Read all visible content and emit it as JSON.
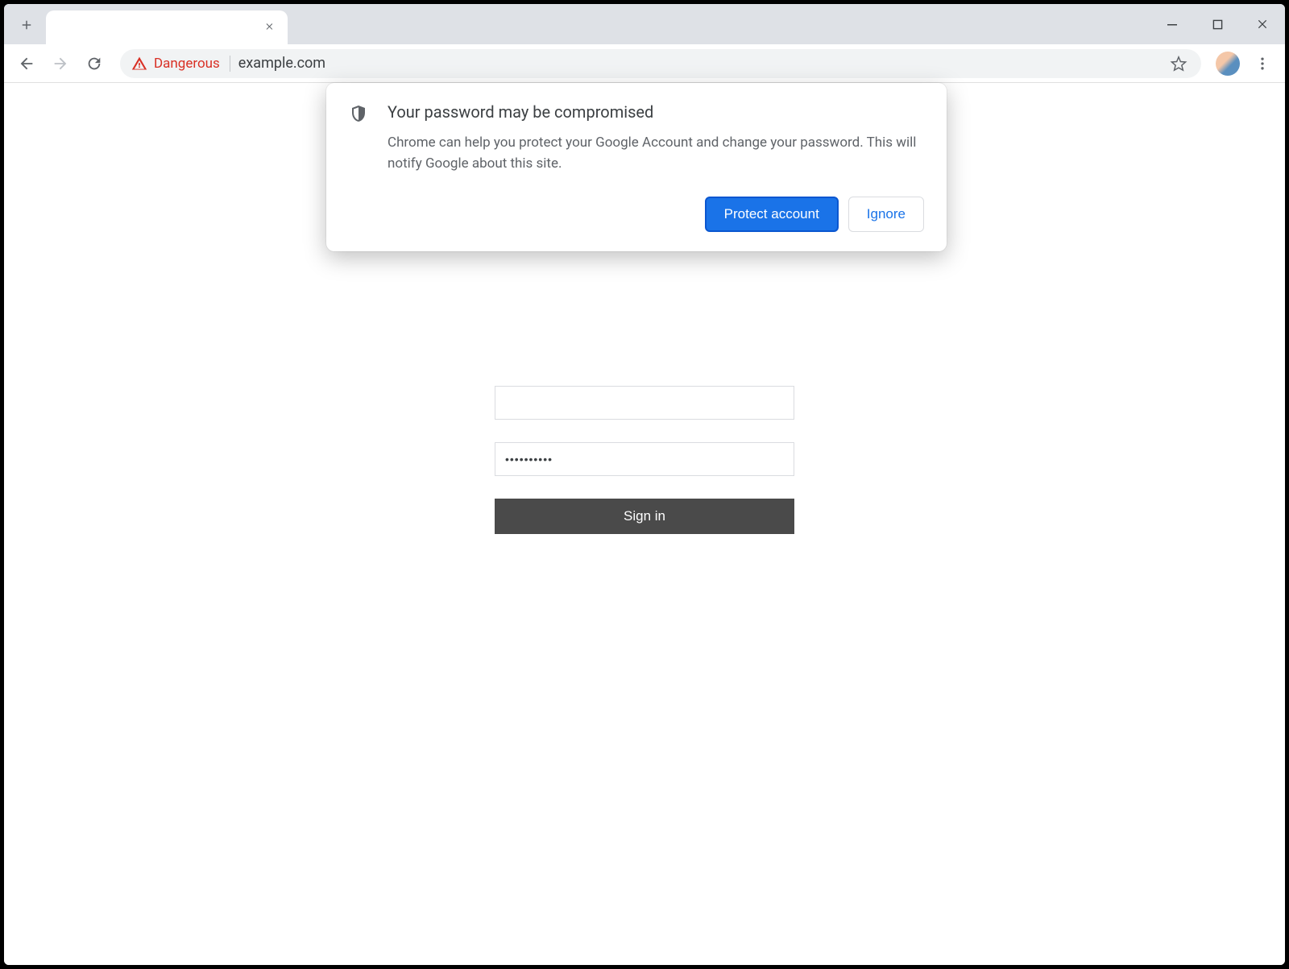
{
  "tab": {
    "title": ""
  },
  "omnibox": {
    "security_label": "Dangerous",
    "url": "example.com"
  },
  "popup": {
    "title": "Your password may be compromised",
    "body": "Chrome can help you protect your Google Account and change your password. This will notify Google about this site.",
    "primary": "Protect account",
    "secondary": "Ignore"
  },
  "form": {
    "username_value": "",
    "password_value": "••••••••••",
    "submit_label": "Sign in"
  }
}
